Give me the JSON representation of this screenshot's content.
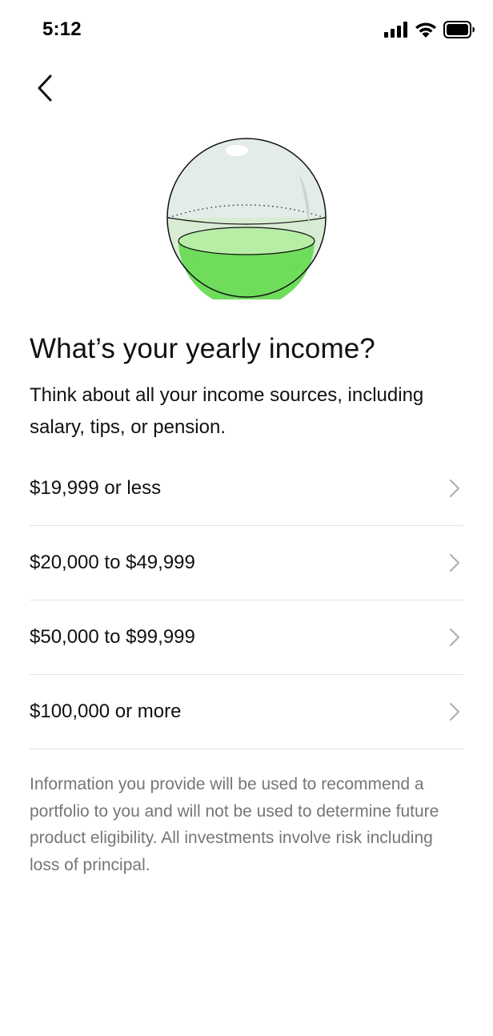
{
  "status_bar": {
    "time": "5:12",
    "icons": [
      "signal-icon",
      "wifi-icon",
      "battery-icon"
    ]
  },
  "navigation": {
    "back_icon": "chevron-left-icon"
  },
  "illustration": {
    "name": "glass-sphere-half-filled",
    "colors": {
      "sphere": "#e3ece7",
      "liquid_light": "#b7eea6",
      "liquid": "#6fdc5c",
      "outline": "#111111"
    }
  },
  "question": {
    "title": "What’s your yearly income?",
    "subtitle": "Think about all your income sources, including salary, tips, or pension."
  },
  "options": [
    {
      "label": "$19,999 or less"
    },
    {
      "label": "$20,000 to $49,999"
    },
    {
      "label": "$50,000 to $99,999"
    },
    {
      "label": "$100,000 or more"
    }
  ],
  "disclaimer": "Information you provide will be used to recommend a portfolio to you and will not be used to determine future product eligibility. All investments involve risk including loss of principal.",
  "colors": {
    "text_primary": "#111111",
    "text_secondary": "#767676",
    "divider": "#e3e3e3",
    "chevron": "#b0b0b0"
  }
}
